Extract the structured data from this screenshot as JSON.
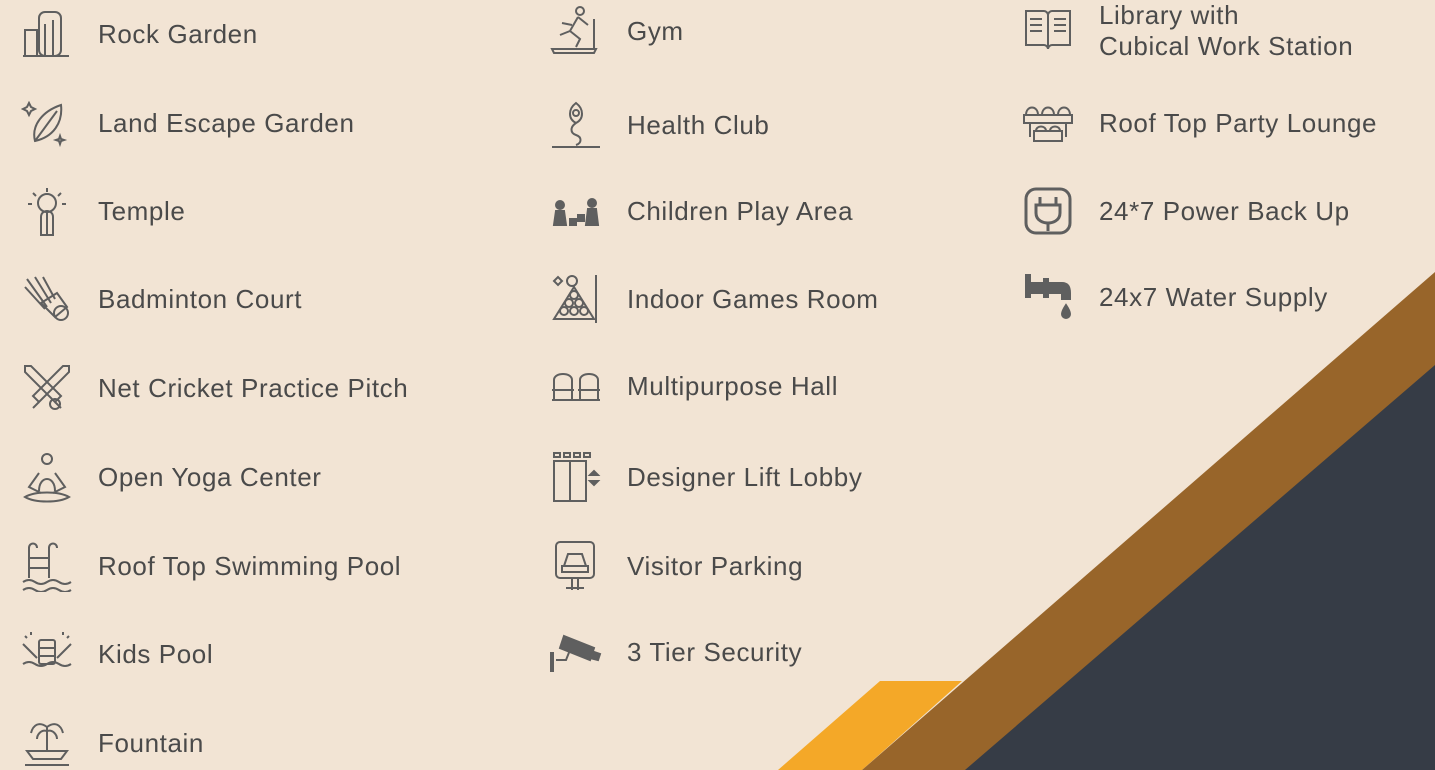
{
  "amenities": {
    "col1": [
      {
        "label": "Rock Garden",
        "icon": "rock-garden-icon"
      },
      {
        "label": "Land Escape Garden",
        "icon": "leaf-sparkle-icon"
      },
      {
        "label": "Temple",
        "icon": "praying-hands-icon"
      },
      {
        "label": "Badminton Court",
        "icon": "shuttlecock-icon"
      },
      {
        "label": "Net Cricket Practice Pitch",
        "icon": "cricket-bats-icon"
      },
      {
        "label": "Open Yoga Center",
        "icon": "yoga-pose-icon"
      },
      {
        "label": "Roof Top Swimming Pool",
        "icon": "pool-ladder-icon"
      },
      {
        "label": "Kids Pool",
        "icon": "kids-pool-icon"
      },
      {
        "label": "Fountain",
        "icon": "fountain-icon"
      }
    ],
    "col2": [
      {
        "label": "Gym",
        "icon": "treadmill-icon"
      },
      {
        "label": "Health Club",
        "icon": "health-club-icon"
      },
      {
        "label": "Children Play Area",
        "icon": "children-play-icon"
      },
      {
        "label": "Indoor Games Room",
        "icon": "billiards-icon"
      },
      {
        "label": "Multipurpose Hall",
        "icon": "hall-seats-icon"
      },
      {
        "label": "Designer Lift Lobby",
        "icon": "elevator-icon"
      },
      {
        "label": "Visitor Parking",
        "icon": "parking-sign-icon"
      },
      {
        "label": "3 Tier Security",
        "icon": "cctv-camera-icon"
      }
    ],
    "col3": [
      {
        "label_line1": "Library with",
        "label_line2": "Cubical Work Station",
        "icon": "book-icon"
      },
      {
        "label": "Roof Top Party Lounge",
        "icon": "lounge-seats-icon"
      },
      {
        "label": "24*7 Power Back Up",
        "icon": "power-plug-icon"
      },
      {
        "label": "24x7 Water Supply",
        "icon": "water-tap-icon"
      }
    ]
  },
  "colors": {
    "background": "#f2e4d4",
    "text": "#4a4a4a",
    "icon": "#5f5f5f",
    "stripe_yellow": "#f4a828",
    "stripe_brown": "#98652a",
    "corner_dark": "#363c46"
  }
}
